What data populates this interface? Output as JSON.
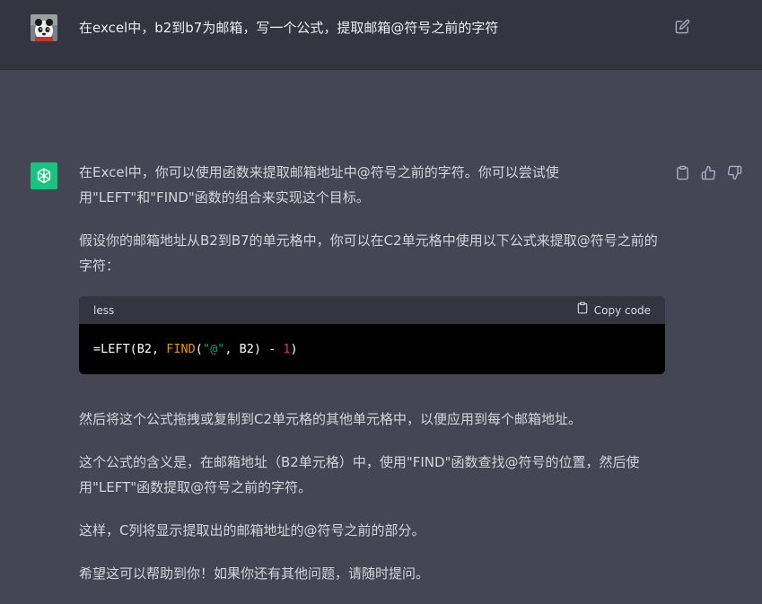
{
  "user_message": {
    "text": "在excel中，b2到b7为邮箱，写一个公式，提取邮箱@符号之前的字符"
  },
  "assistant_message": {
    "paragraphs": [
      "在Excel中，你可以使用函数来提取邮箱地址中@符号之前的字符。你可以尝试使用\"LEFT\"和\"FIND\"函数的组合来实现这个目标。",
      "假设你的邮箱地址从B2到B7的单元格中，你可以在C2单元格中使用以下公式来提取@符号之前的字符：",
      "然后将这个公式拖拽或复制到C2单元格的其他单元格中，以便应用到每个邮箱地址。",
      "这个公式的含义是，在邮箱地址（B2单元格）中，使用\"FIND\"函数查找@符号的位置，然后使用\"LEFT\"函数提取@符号之前的字符。",
      "这样，C列将显示提取出的邮箱地址的@符号之前的部分。",
      "希望这可以帮助到你！如果你还有其他问题，请随时提问。"
    ],
    "code": {
      "language": "less",
      "copy_label": "Copy code",
      "tokens": {
        "t1": "=LEFT(B2, ",
        "t2": "FIND",
        "t3": "(",
        "t4": "\"@\"",
        "t5": ", B2) - ",
        "t6": "1",
        "t7": ")"
      }
    }
  },
  "icons": {
    "edit": "edit-icon",
    "copy": "clipboard-icon",
    "thumbs_up": "thumbs-up-icon",
    "thumbs_down": "thumbs-down-icon",
    "bot_avatar": "openai-logo-icon"
  },
  "colors": {
    "user_bg": "#343541",
    "assistant_bg": "#444654",
    "bot_avatar_bg": "#19c37d"
  }
}
